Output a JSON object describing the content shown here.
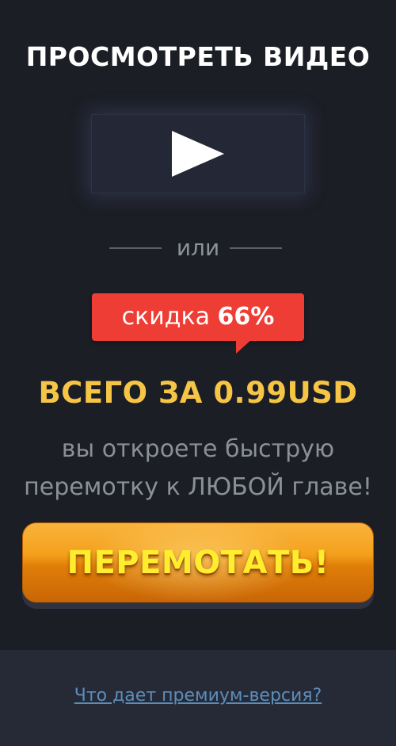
{
  "header": {
    "title": "ПРОСМОТРЕТЬ ВИДЕО"
  },
  "video": {
    "play_icon": "play-icon"
  },
  "divider": {
    "or_label": "или"
  },
  "discount": {
    "prefix": "скидка",
    "percent": "66%",
    "color": "#ee3d35"
  },
  "offer": {
    "price_text": "ВСЕГО ЗА 0.99USD",
    "description_line1": "вы откроете быструю",
    "description_line2": "перемотку к ЛЮБОЙ главе!"
  },
  "cta": {
    "rewind_label": "ПЕРЕМОТАТЬ!",
    "accent_color": "#f4a01b"
  },
  "footer": {
    "premium_link": "Что дает премиум-версия?"
  }
}
